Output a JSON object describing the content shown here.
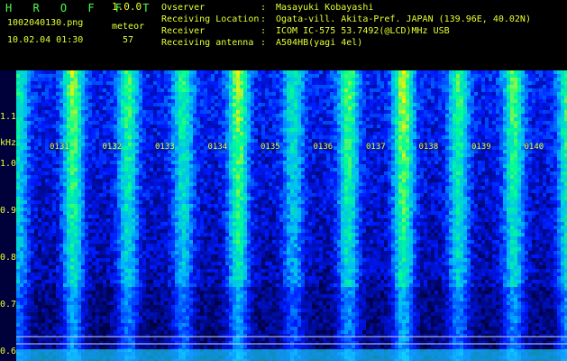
{
  "header": {
    "title": "H R O F F T",
    "version": "1.0.0",
    "file_name": "1002040130.png",
    "timestamp": "10.02.04 01:30",
    "event_label": "meteor",
    "event_count": "57"
  },
  "info": {
    "observer_label": "Ovserver",
    "observer_value": "Masayuki Kobayashi",
    "location_label": "Receiving Location",
    "location_value": "Ogata-vill. Akita-Pref. JAPAN (139.96E, 40.02N)",
    "receiver_label": "Receiver",
    "receiver_value": "ICOM IC-575 53.7492(@LCD)MHz USB",
    "antenna_label": "Receiving antenna",
    "antenna_value": "A504HB(yagi 4el)",
    "separator": ":"
  },
  "chart_data": {
    "type": "heatmap",
    "title": "",
    "xlabel": "",
    "ylabel": "kHz",
    "x_ticks": [
      "0131",
      "0132",
      "0133",
      "0134",
      "0135",
      "0136",
      "0137",
      "0138",
      "0139",
      "0140"
    ],
    "y_ticks": [
      "1.1",
      "1.0",
      "0.9",
      "0.8",
      "0.7",
      "0.6"
    ],
    "ylim": [
      0.58,
      1.2
    ],
    "colorscale": [
      "#00003a",
      "#0018ff",
      "#00b5ff",
      "#00ff94",
      "#fff100"
    ],
    "grid": false,
    "legend": "none",
    "data_labels": "none",
    "bright_bands": [
      {
        "x": "0130",
        "intensity": 0.62
      },
      {
        "x": "0131",
        "intensity": 0.86
      },
      {
        "x": "0132",
        "intensity": 0.72
      },
      {
        "x": "0133",
        "intensity": 0.66
      },
      {
        "x": "0134",
        "intensity": 0.88
      },
      {
        "x": "0135",
        "intensity": 0.56
      },
      {
        "x": "0136",
        "intensity": 0.78
      },
      {
        "x": "0137",
        "intensity": 0.92
      },
      {
        "x": "0138",
        "intensity": 0.73
      },
      {
        "x": "0139",
        "intensity": 0.77
      },
      {
        "x": "0140",
        "intensity": 0.8
      }
    ]
  }
}
